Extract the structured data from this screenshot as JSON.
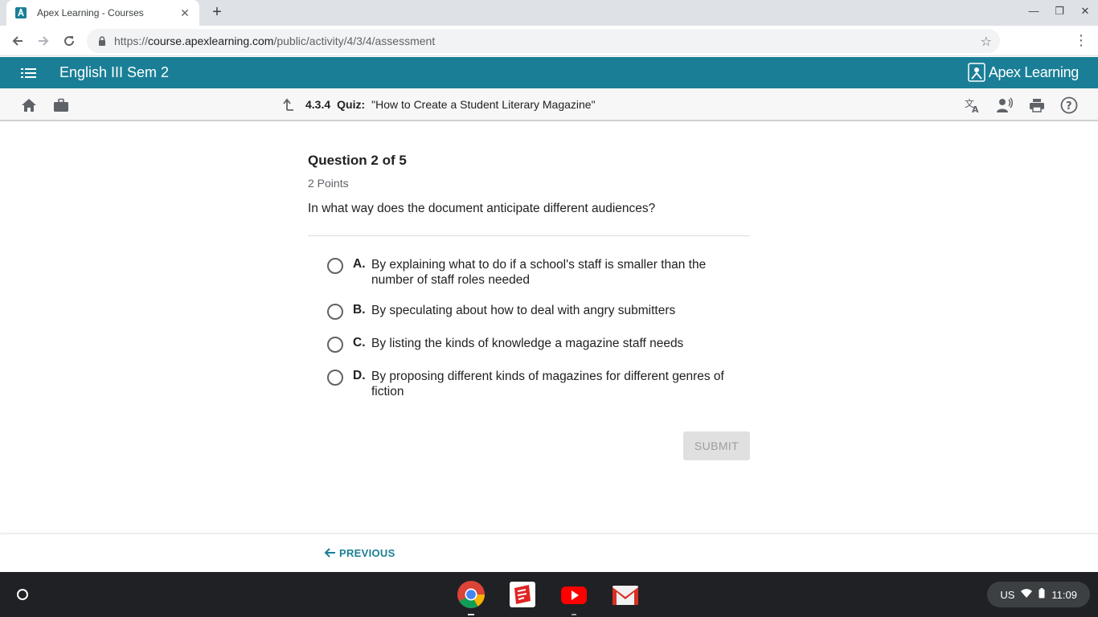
{
  "browser": {
    "tab_title": "Apex Learning - Courses",
    "url_scheme": "https://",
    "url_host": "course.apexlearning.com",
    "url_path": "/public/activity/4/3/4/assessment"
  },
  "app": {
    "course_title": "English III Sem 2",
    "brand": "Apex Learning"
  },
  "activity": {
    "number": "4.3.4",
    "type": "Quiz:",
    "name": "\"How to Create a Student Literary Magazine\""
  },
  "question": {
    "heading": "Question 2 of 5",
    "points": "2 Points",
    "prompt": "In what way does the document anticipate different audiences?",
    "choices": [
      {
        "letter": "A.",
        "text": "By explaining what to do if a school's staff is smaller than the number of staff roles needed"
      },
      {
        "letter": "B.",
        "text": "By speculating about how to deal with angry submitters"
      },
      {
        "letter": "C.",
        "text": "By listing the kinds of knowledge a magazine staff needs"
      },
      {
        "letter": "D.",
        "text": "By proposing different kinds of magazines for different genres of fiction"
      }
    ],
    "submit_label": "SUBMIT"
  },
  "footer": {
    "previous_label": "PREVIOUS"
  },
  "shelf": {
    "locale": "US",
    "time": "11:09"
  },
  "colors": {
    "accent": "#1a7f96",
    "shelf": "#202124"
  }
}
